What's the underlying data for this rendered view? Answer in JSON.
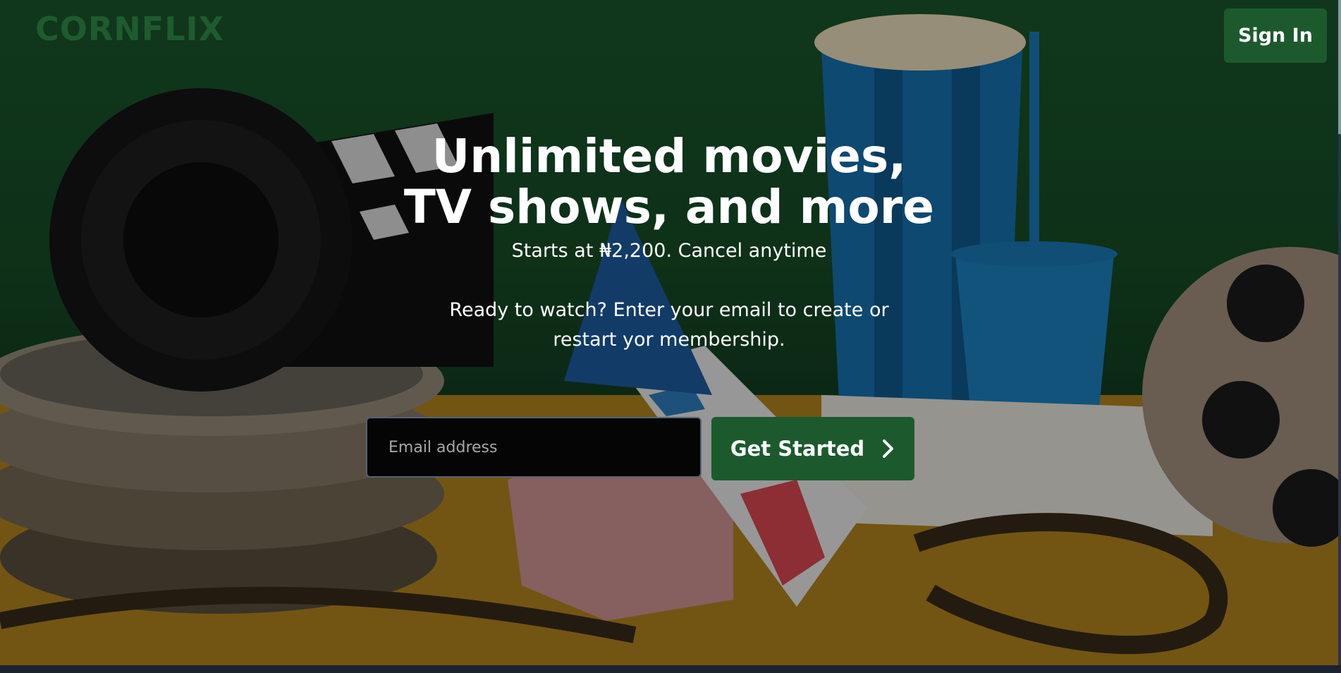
{
  "brand": {
    "logo_text": "CORNFLIX"
  },
  "header": {
    "signin_label": "Sign In"
  },
  "hero": {
    "headline": "Unlimited movies, TV shows, and more",
    "subline": "Starts at ₦2,200. Cancel anytime",
    "prompt": "Ready to watch? Enter your email to create or restart yor membership."
  },
  "signup": {
    "email_placeholder": "Email address",
    "email_value": "",
    "cta_label": "Get Started",
    "cta_icon": "chevron-right-icon"
  },
  "colors": {
    "brand_green": "#1c5a2e",
    "background_green": "#1a5a2d",
    "input_background": "#050505"
  }
}
